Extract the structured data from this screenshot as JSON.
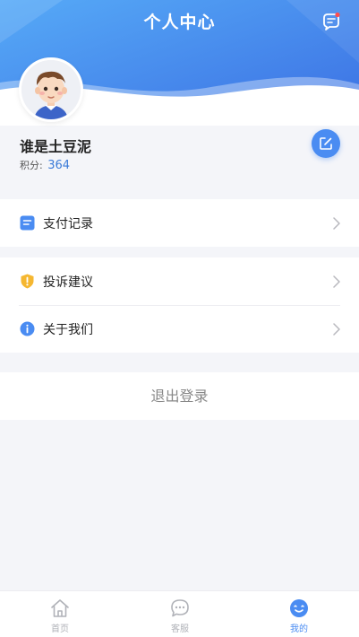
{
  "header": {
    "title": "个人中心"
  },
  "profile": {
    "username": "谁是土豆泥",
    "points_label": "积分:",
    "points_value": "364"
  },
  "menu_group_1": [
    {
      "label": "支付记录",
      "icon": "document-icon"
    }
  ],
  "menu_group_2": [
    {
      "label": "投诉建议",
      "icon": "shield-alert-icon"
    },
    {
      "label": "关于我们",
      "icon": "info-icon"
    }
  ],
  "logout_label": "退出登录",
  "tabbar": [
    {
      "label": "首页",
      "icon": "home-icon",
      "active": false
    },
    {
      "label": "客服",
      "icon": "chat-icon",
      "active": false
    },
    {
      "label": "我的",
      "icon": "user-icon",
      "active": true
    }
  ],
  "colors": {
    "accent": "#4a8cf2",
    "header_gradient_start": "#4a9ff5",
    "header_gradient_end": "#3d74e6",
    "warning": "#f5b731",
    "logout_text": "#888888"
  }
}
